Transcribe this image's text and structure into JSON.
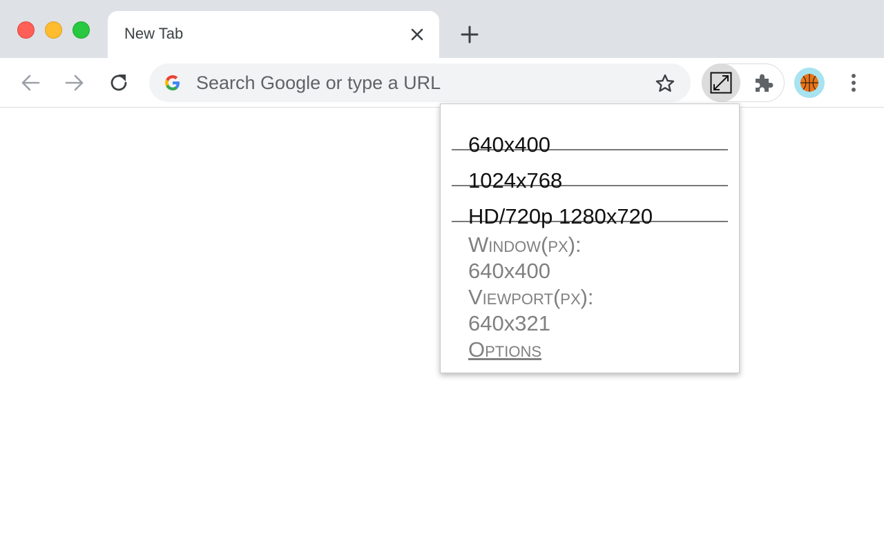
{
  "window": {
    "traffic_lights": {
      "close_color": "#fe5f57",
      "minimize_color": "#febc2e",
      "maximize_color": "#28c840"
    }
  },
  "tabs": [
    {
      "title": "New Tab",
      "active": true
    }
  ],
  "toolbar": {
    "omnibox_placeholder": "Search Google or type a URL",
    "icons": [
      "back-arrow-icon",
      "forward-arrow-icon",
      "reload-icon",
      "google-g-icon",
      "star-icon",
      "resize-extension-icon",
      "puzzle-icon",
      "basketball-avatar-icon",
      "kebab-menu-icon"
    ]
  },
  "popup": {
    "presets": [
      "640x400",
      "1024x768",
      "HD/720p 1280x720"
    ],
    "window_label": "Window(px):",
    "window_value": "640x400",
    "viewport_label": "Viewport(px):",
    "viewport_value": "640x321",
    "options_label": "Options"
  }
}
